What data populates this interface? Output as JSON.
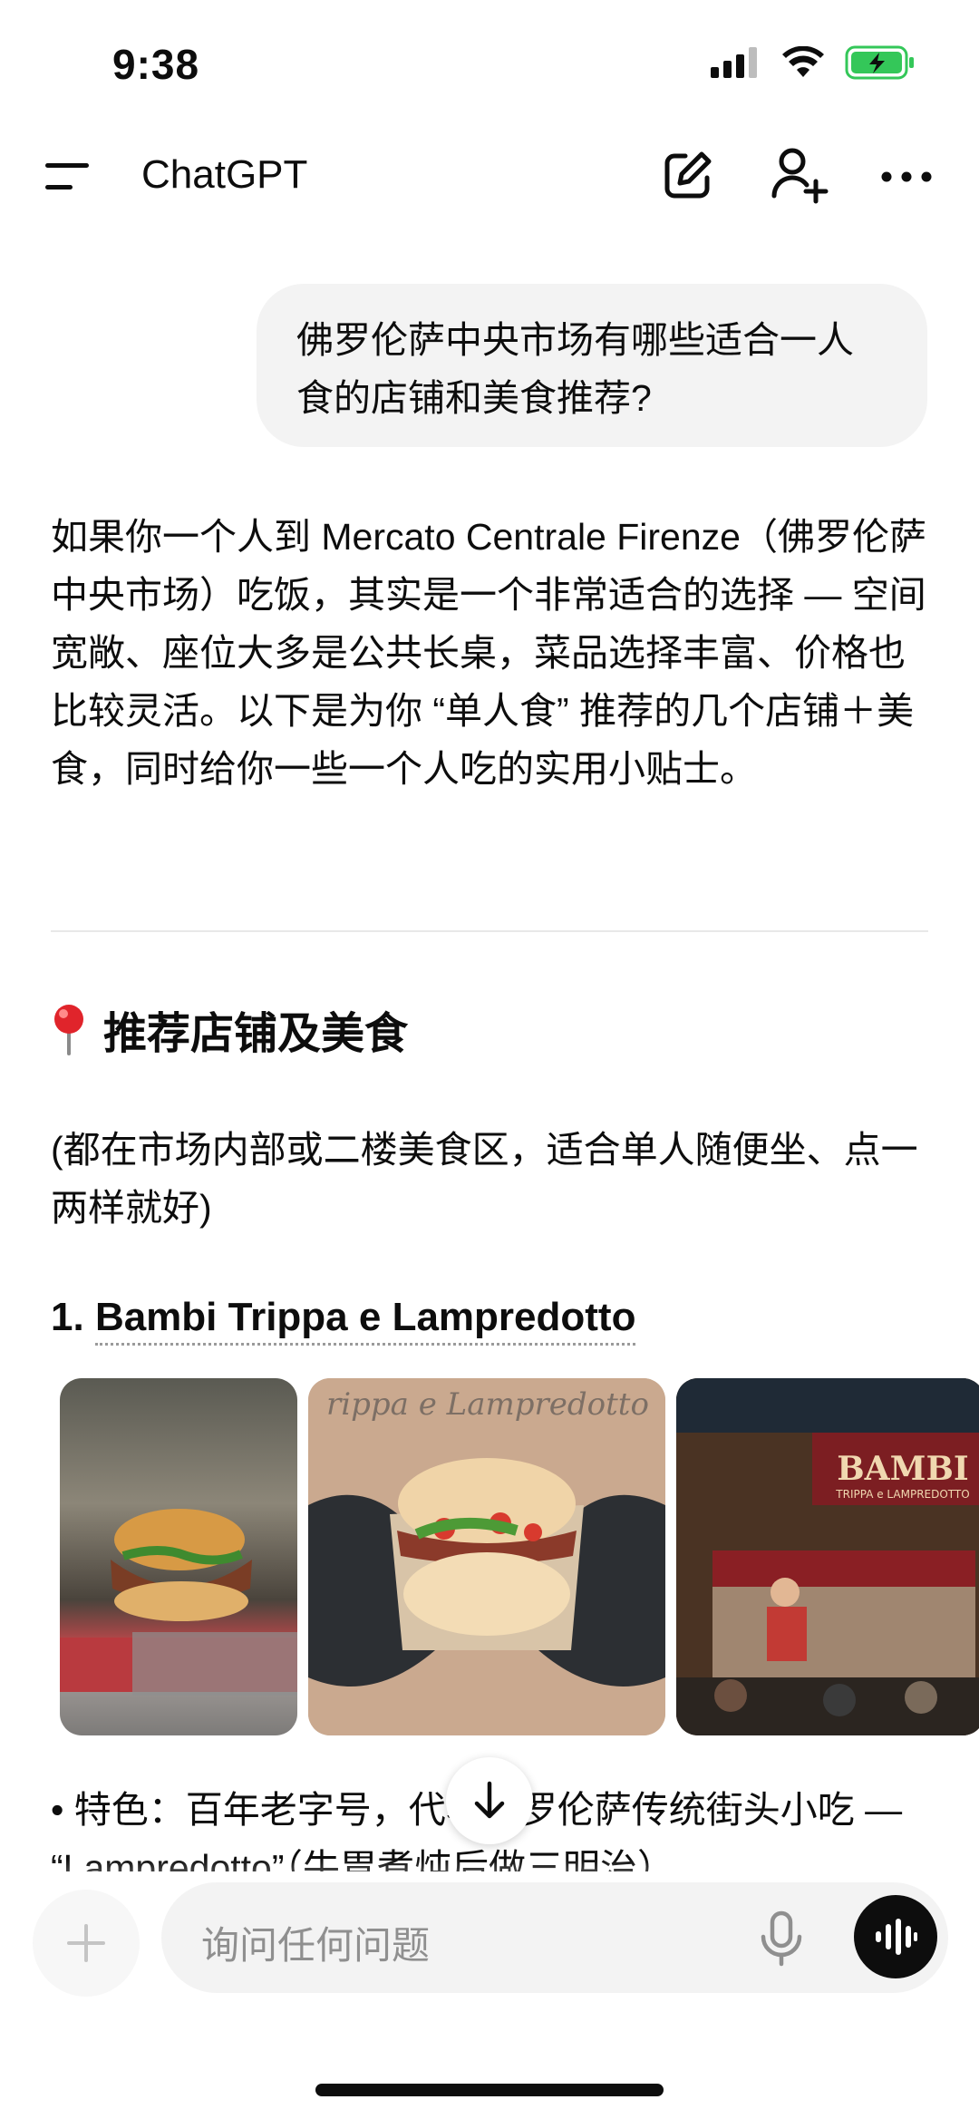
{
  "status_bar": {
    "time": "9:38"
  },
  "header": {
    "title": "ChatGPT"
  },
  "user_message": "佛罗伦萨中央市场有哪些适合一人食的店铺和美食推荐?",
  "assistant": {
    "intro": "如果你一个人到 Mercato Centrale Firenze（佛罗伦萨中央市场）吃饭，其实是一个非常适合的选择 — 空间宽敞、座位大多是公共长桌，菜品选择丰富、价格也比较灵活。以下是为你 “单人食” 推荐的几个店铺＋美食，同时给你一些一个人吃的实用小贴士。",
    "section_heading": "推荐店铺及美食",
    "section_icon": "pin-icon",
    "section_note": "(都在市场内部或二楼美食区，适合单人随便坐、点一两样就好)",
    "item1": {
      "number": "1.",
      "name": "Bambi Trippa e Lampredotto",
      "photos": [
        "lampredotto-sandwich-on-board",
        "hands-holding-sandwich",
        "bambi-stall-counter"
      ],
      "stall_sign": "BAMBI",
      "stall_sign_sub": "TRIPPA e LAMPREDOTTO",
      "bullet": "特色：百年老字号，代表佛罗伦萨传统街头小吃 — “Lampredotto”（牛胃煮炖后做三明治）"
    }
  },
  "composer": {
    "placeholder": "询问任何问题"
  },
  "colors": {
    "bubble": "#f3f3f3",
    "text": "#0d0d0d",
    "placeholder": "#8f8f8f",
    "battery": "#34c759"
  }
}
